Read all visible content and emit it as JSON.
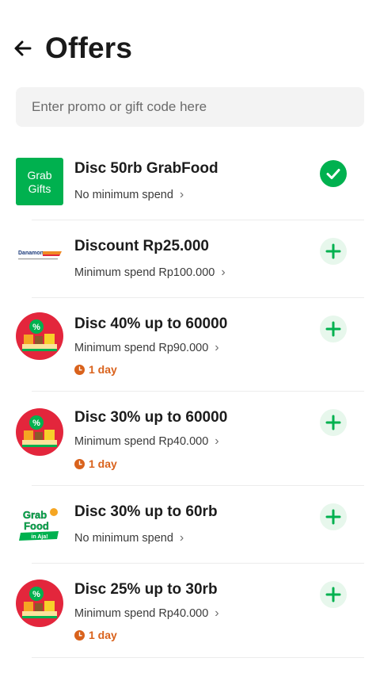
{
  "header": {
    "title": "Offers"
  },
  "promo": {
    "placeholder": "Enter promo or gift code here"
  },
  "offers": [
    {
      "title": "Disc 50rb GrabFood",
      "subtitle": "No minimum spend",
      "expiry": "",
      "status": "applied",
      "image": "grab-gifts-logo",
      "image_text": "Grab Gifts"
    },
    {
      "title": "Discount Rp25.000",
      "subtitle": "Minimum spend Rp100.000",
      "expiry": "",
      "status": "add",
      "image": "danamon-logo",
      "image_text": "Danamon"
    },
    {
      "title": "Disc 40% up to 60000",
      "subtitle": "Minimum spend Rp90.000",
      "expiry": "1 day",
      "status": "add",
      "image": "grabfood-promo-badge",
      "image_text": "%"
    },
    {
      "title": "Disc 30% up to 60000",
      "subtitle": "Minimum spend Rp40.000",
      "expiry": "1 day",
      "status": "add",
      "image": "grabfood-promo-badge",
      "image_text": "%"
    },
    {
      "title": "Disc 30% up to 60rb",
      "subtitle": "No minimum spend",
      "expiry": "",
      "status": "add",
      "image": "grabfood-in-aja-logo",
      "image_text": "Grab Food in Aja!"
    },
    {
      "title": "Disc 25% up to 30rb",
      "subtitle": "Minimum spend Rp40.000",
      "expiry": "1 day",
      "status": "add",
      "image": "grabfood-promo-badge",
      "image_text": "%"
    }
  ],
  "colors": {
    "brand_green": "#00b14f",
    "add_bg": "#e7f7ec",
    "expiry_orange": "#d9621c",
    "badge_red": "#e3263c"
  },
  "icons": {
    "back": "arrow-left-icon",
    "chevron": "chevron-right-icon",
    "add": "plus-icon",
    "applied": "check-icon",
    "clock": "clock-icon"
  }
}
